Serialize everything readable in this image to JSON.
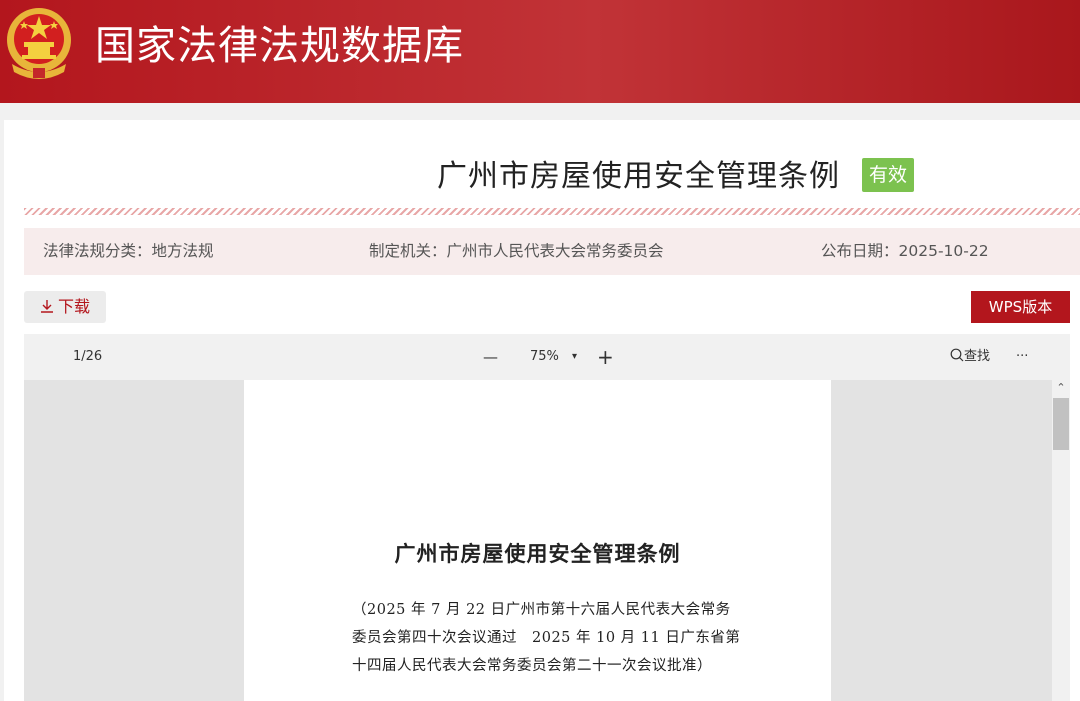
{
  "site": {
    "title": "国家法律法规数据库"
  },
  "document": {
    "title": "广州市房屋使用安全管理条例",
    "status": "有效",
    "category": "法律法规分类：地方法规",
    "authority": "制定机关：广州市人民代表大会常务委员会",
    "date": "公布日期：2025-10-22"
  },
  "actions": {
    "download_label": "下载",
    "wps_label": "WPS版本"
  },
  "viewer": {
    "page_indicator": "1/26",
    "zoom": "75%",
    "zoom_out": "—",
    "zoom_in": "+",
    "zoom_dropdown": "▾",
    "search_label": "查找",
    "more": "···"
  },
  "page": {
    "title": "广州市房屋使用安全管理条例",
    "note_lines": [
      "（2025 年 7 月 22 日广州市第十六届人民代表大会常务",
      "委员会第四十次会议通过　2025 年 10 月 11 日广东省第",
      "十四届人民代表大会常务委员会第二十一次会议批准）"
    ]
  },
  "colors": {
    "brand_red": "#b3161d",
    "status_green": "#7cc24f"
  }
}
